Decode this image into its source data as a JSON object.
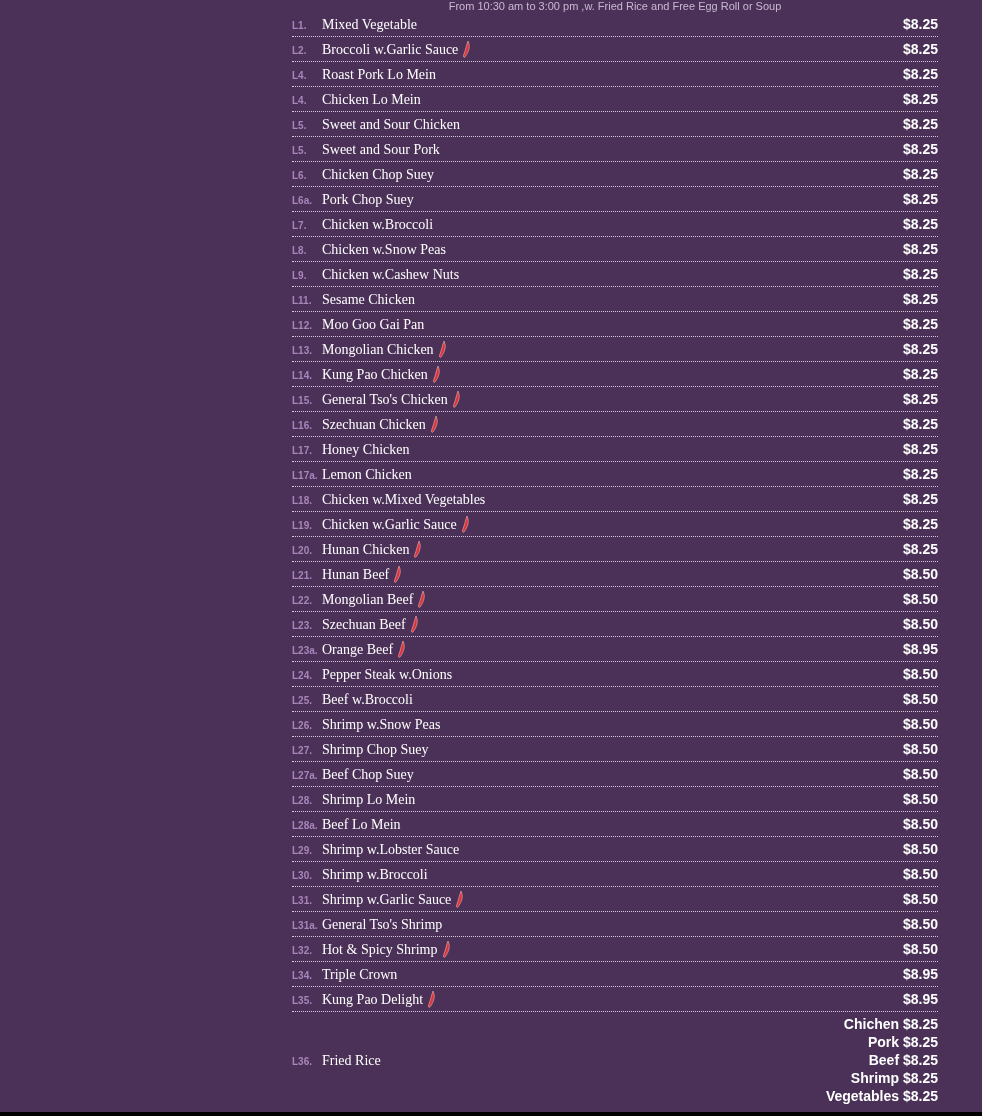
{
  "header": "From 10:30 am to 3:00 pm ,w. Fried Rice and Free Egg Roll or Soup",
  "items": [
    {
      "code": "L1.",
      "name": "Mixed Vegetable",
      "spicy": false,
      "price": "$8.25"
    },
    {
      "code": "L2.",
      "name": "Broccoli w.Garlic Sauce",
      "spicy": true,
      "price": "$8.25"
    },
    {
      "code": "L4.",
      "name": "Roast Pork Lo Mein",
      "spicy": false,
      "price": "$8.25"
    },
    {
      "code": "L4.",
      "name": "Chicken Lo Mein",
      "spicy": false,
      "price": "$8.25"
    },
    {
      "code": "L5.",
      "name": "Sweet and Sour Chicken",
      "spicy": false,
      "price": "$8.25"
    },
    {
      "code": "L5.",
      "name": "Sweet and Sour Pork",
      "spicy": false,
      "price": "$8.25"
    },
    {
      "code": "L6.",
      "name": "Chicken Chop Suey",
      "spicy": false,
      "price": "$8.25"
    },
    {
      "code": "L6a.",
      "name": "Pork Chop Suey",
      "spicy": false,
      "price": "$8.25"
    },
    {
      "code": "L7.",
      "name": "Chicken w.Broccoli",
      "spicy": false,
      "price": "$8.25"
    },
    {
      "code": "L8.",
      "name": "Chicken w.Snow Peas",
      "spicy": false,
      "price": "$8.25"
    },
    {
      "code": "L9.",
      "name": "Chicken w.Cashew Nuts",
      "spicy": false,
      "price": "$8.25"
    },
    {
      "code": "L11.",
      "name": "Sesame Chicken",
      "spicy": false,
      "price": "$8.25"
    },
    {
      "code": "L12.",
      "name": "Moo Goo Gai Pan",
      "spicy": false,
      "price": "$8.25"
    },
    {
      "code": "L13.",
      "name": "Mongolian Chicken",
      "spicy": true,
      "price": "$8.25"
    },
    {
      "code": "L14.",
      "name": "Kung Pao Chicken",
      "spicy": true,
      "price": "$8.25"
    },
    {
      "code": "L15.",
      "name": "General Tso's Chicken",
      "spicy": true,
      "price": "$8.25"
    },
    {
      "code": "L16.",
      "name": "Szechuan Chicken",
      "spicy": true,
      "price": "$8.25"
    },
    {
      "code": "L17.",
      "name": "Honey Chicken",
      "spicy": false,
      "price": "$8.25"
    },
    {
      "code": "L17a.",
      "name": "Lemon Chicken",
      "spicy": false,
      "price": "$8.25"
    },
    {
      "code": "L18.",
      "name": "Chicken w.Mixed Vegetables",
      "spicy": false,
      "price": "$8.25"
    },
    {
      "code": "L19.",
      "name": "Chicken w.Garlic Sauce",
      "spicy": true,
      "price": "$8.25"
    },
    {
      "code": "L20.",
      "name": "Hunan Chicken",
      "spicy": true,
      "price": "$8.25"
    },
    {
      "code": "L21.",
      "name": "Hunan Beef",
      "spicy": true,
      "price": "$8.50"
    },
    {
      "code": "L22.",
      "name": "Mongolian Beef",
      "spicy": true,
      "price": "$8.50"
    },
    {
      "code": "L23.",
      "name": "Szechuan Beef",
      "spicy": true,
      "price": "$8.50"
    },
    {
      "code": "L23a.",
      "name": "Orange Beef",
      "spicy": true,
      "price": "$8.95"
    },
    {
      "code": "L24.",
      "name": "Pepper Steak w.Onions",
      "spicy": false,
      "price": "$8.50"
    },
    {
      "code": "L25.",
      "name": "Beef w.Broccoli",
      "spicy": false,
      "price": "$8.50"
    },
    {
      "code": "L26.",
      "name": "Shrimp w.Snow Peas",
      "spicy": false,
      "price": "$8.50"
    },
    {
      "code": "L27.",
      "name": "Shrimp Chop Suey",
      "spicy": false,
      "price": "$8.50"
    },
    {
      "code": "L27a.",
      "name": "Beef Chop Suey",
      "spicy": false,
      "price": "$8.50"
    },
    {
      "code": "L28.",
      "name": "Shrimp Lo Mein",
      "spicy": false,
      "price": "$8.50"
    },
    {
      "code": "L28a.",
      "name": "Beef Lo Mein",
      "spicy": false,
      "price": "$8.50"
    },
    {
      "code": "L29.",
      "name": "Shrimp w.Lobster Sauce",
      "spicy": false,
      "price": "$8.50"
    },
    {
      "code": "L30.",
      "name": "Shrimp w.Broccoli",
      "spicy": false,
      "price": "$8.50"
    },
    {
      "code": "L31.",
      "name": "Shrimp w.Garlic Sauce",
      "spicy": true,
      "price": "$8.50"
    },
    {
      "code": "L31a.",
      "name": "General Tso's Shrimp",
      "spicy": false,
      "price": "$8.50"
    },
    {
      "code": "L32.",
      "name": "Hot & Spicy Shrimp",
      "spicy": true,
      "price": "$8.50"
    },
    {
      "code": "L34.",
      "name": "Triple Crown",
      "spicy": false,
      "price": "$8.95"
    },
    {
      "code": "L35.",
      "name": "Kung Pao Delight",
      "spicy": true,
      "price": "$8.95"
    }
  ],
  "multi_item": {
    "code": "L36.",
    "name": "Fried Rice",
    "options": [
      {
        "label": "Chichen",
        "price": "$8.25"
      },
      {
        "label": "Pork",
        "price": "$8.25"
      },
      {
        "label": "Beef",
        "price": "$8.25"
      },
      {
        "label": "Shrimp",
        "price": "$8.25"
      },
      {
        "label": "Vegetables",
        "price": "$8.25"
      }
    ]
  }
}
